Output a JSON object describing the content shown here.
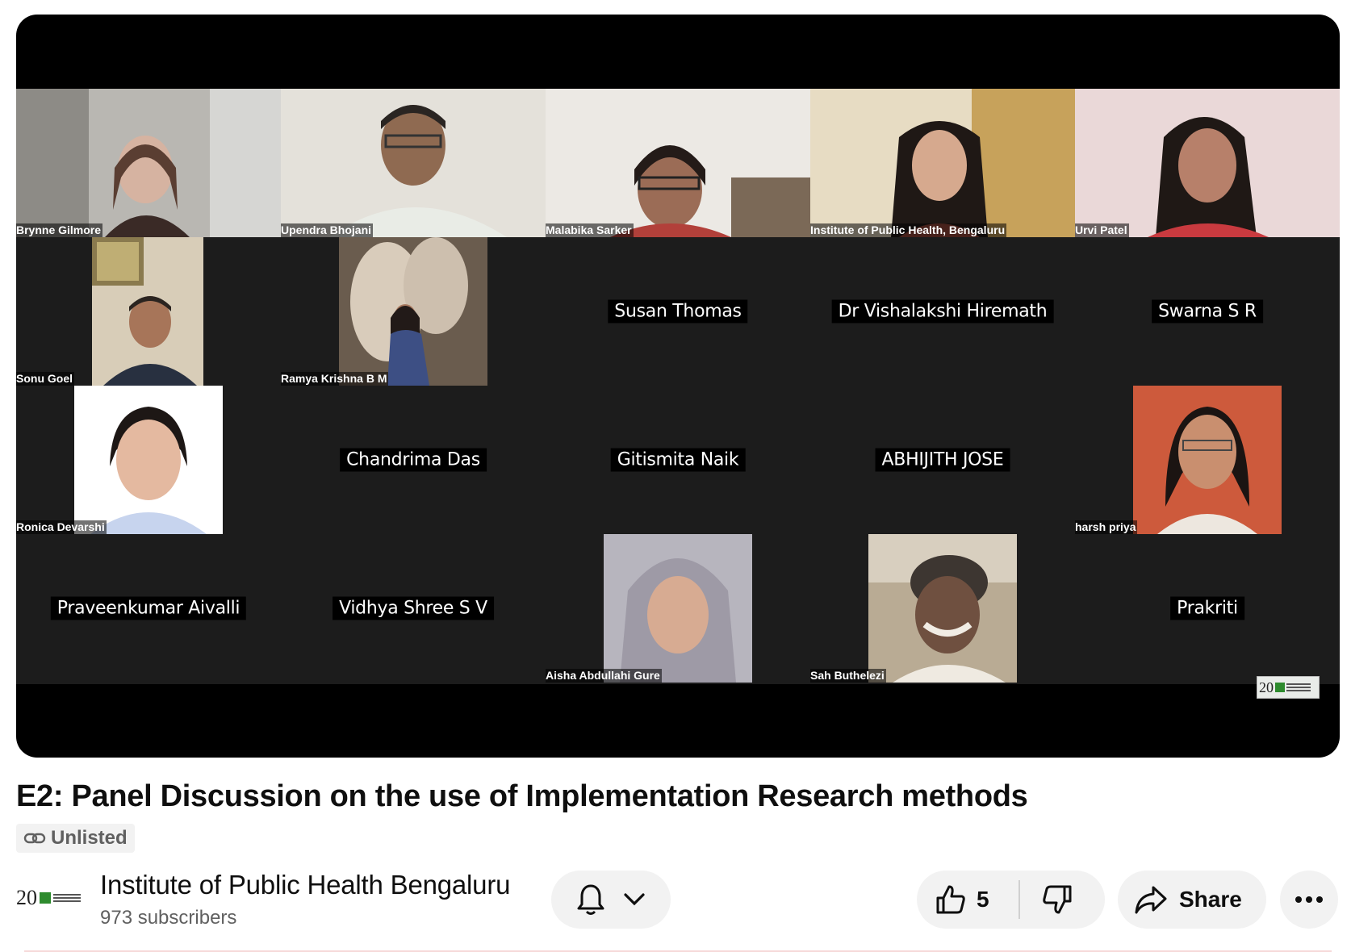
{
  "video": {
    "title": "E2: Panel Discussion on the use of Implementation Research methods",
    "visibility": "Unlisted",
    "watermark_number": "20"
  },
  "participants": {
    "brynne": "Brynne Gilmore",
    "upendra": "Upendra Bhojani",
    "malabika": "Malabika Sarker",
    "iph": "Institute of Public Health, Bengaluru",
    "urvi": "Urvi Patel",
    "sonu": "Sonu Goel",
    "ramya": "Ramya Krishna B M",
    "susan": "Susan Thomas",
    "vishalakshi": "Dr Vishalakshi Hiremath",
    "swarna": "Swarna S R",
    "ronica": "Ronica Devarshi",
    "chandrima": "Chandrima Das",
    "gitismita": "Gitismita Naik",
    "abhijith": "ABHIJITH JOSE",
    "harsh": "harsh priya",
    "praveen": "Praveenkumar Aivalli",
    "vidhya": "Vidhya Shree S V",
    "aisha": "Aisha Abdullahi Gure",
    "sah": "Sah Buthelezi",
    "prakriti": "Prakriti"
  },
  "channel": {
    "name": "Institute of Public Health Bengaluru",
    "subscribers": "973 subscribers",
    "avatar_number": "20"
  },
  "actions": {
    "likes": "5",
    "share_label": "Share"
  },
  "icons": [
    "link-icon",
    "bell-icon",
    "chevron-down-icon",
    "thumbs-up-icon",
    "thumbs-down-icon",
    "share-icon",
    "more-icon"
  ]
}
